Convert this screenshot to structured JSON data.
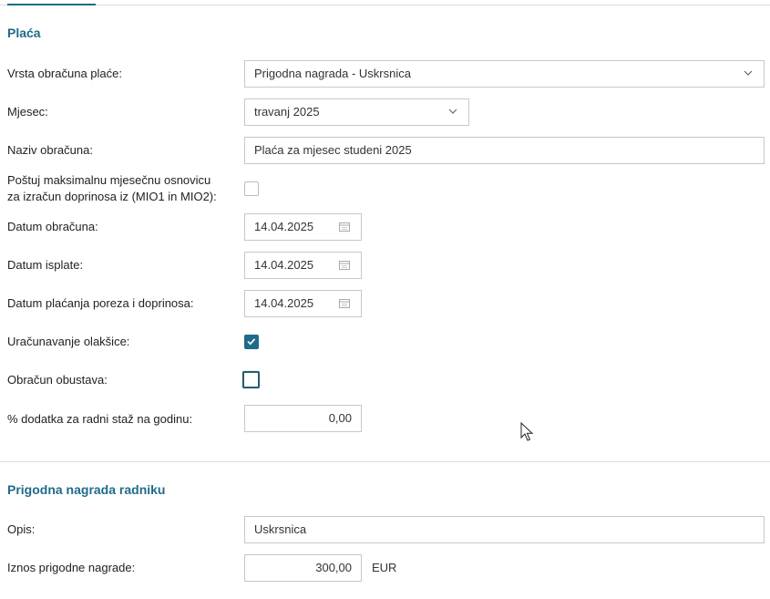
{
  "placa": {
    "title": "Plaća",
    "vrsta": {
      "label": "Vrsta obračuna plaće:",
      "value": "Prigodna nagrada - Uskrsnica"
    },
    "mjesec": {
      "label": "Mjesec:",
      "value": "travanj 2025"
    },
    "naziv": {
      "label": "Naziv obračuna:",
      "value": "Plaća za mjesec studeni 2025"
    },
    "postuj": {
      "label_line1": "Poštuj maksimalnu mjesečnu osnovicu",
      "label_line2": "za izračun doprinosa iz (MIO1 in MIO2):",
      "checked": false
    },
    "datum_obracuna": {
      "label": "Datum obračuna:",
      "value": "14.04.2025"
    },
    "datum_isplate": {
      "label": "Datum isplate:",
      "value": "14.04.2025"
    },
    "datum_placanja": {
      "label": "Datum plaćanja poreza i doprinosa:",
      "value": "14.04.2025"
    },
    "olaksice": {
      "label": "Uračunavanje olakšice:",
      "checked": true
    },
    "obustave": {
      "label": "Obračun obustava:",
      "checked": false
    },
    "dodatak": {
      "label": "% dodatka za radni staž na godinu:",
      "value": "0,00"
    }
  },
  "nagrada": {
    "title": "Prigodna nagrada radniku",
    "opis": {
      "label": "Opis:",
      "value": "Uskrsnica"
    },
    "iznos": {
      "label": "Iznos prigodne nagrade:",
      "value": "300,00",
      "unit": "EUR"
    }
  },
  "colors": {
    "accent": "#1f6b8a",
    "border": "#c8c8c8"
  },
  "icons": {
    "select": "chevron-down-icon",
    "date": "calendar-icon",
    "check": "check-icon",
    "pointer": "mouse-cursor-icon"
  }
}
